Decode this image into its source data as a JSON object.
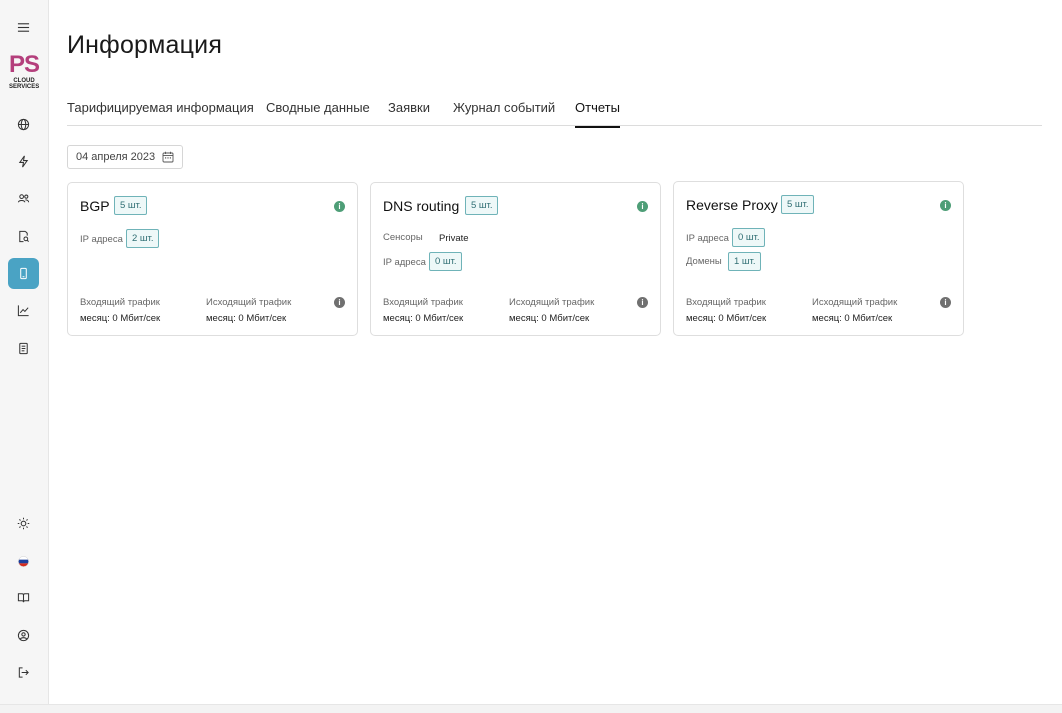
{
  "logo": {
    "ps": "PS",
    "line1": "CLOUD",
    "line2": "SERVICES"
  },
  "page": {
    "title": "Информация"
  },
  "tabs": [
    {
      "label": "Тарифицируемая информация"
    },
    {
      "label": "Сводные данные"
    },
    {
      "label": "Заявки"
    },
    {
      "label": "Журнал событий"
    },
    {
      "label": "Отчеты",
      "active": true
    }
  ],
  "date_picker": {
    "value": "04 апреля 2023"
  },
  "cards": [
    {
      "title": "BGP",
      "count": "5 шт.",
      "rows": [
        {
          "label": "IP адреса",
          "badge": "2 шт."
        }
      ],
      "incoming_label": "Входящий трафик",
      "incoming_value": "месяц: 0 Мбит/сек",
      "outgoing_label": "Исходящий трафик",
      "outgoing_value": "месяц: 0 Мбит/сек"
    },
    {
      "title": "DNS routing",
      "count": "5 шт.",
      "rows": [
        {
          "label": "Сенсоры",
          "value": "Private"
        },
        {
          "label": "IP адреса",
          "badge": "0 шт."
        }
      ],
      "incoming_label": "Входящий трафик",
      "incoming_value": "месяц: 0 Мбит/сек",
      "outgoing_label": "Исходящий трафик",
      "outgoing_value": "месяц: 0 Мбит/сек"
    },
    {
      "title": "Reverse Proxy",
      "count": "5 шт.",
      "rows": [
        {
          "label": "IP адреса",
          "badge": "0 шт."
        },
        {
          "label": "Домены",
          "badge": "1 шт."
        }
      ],
      "incoming_label": "Входящий трафик",
      "incoming_value": "месяц: 0 Мбит/сек",
      "outgoing_label": "Исходящий трафик",
      "outgoing_value": "месяц: 0 Мбит/сек"
    }
  ],
  "colors": {
    "accent": "#4aa3c4",
    "brand": "#b43f7c",
    "badge_border": "#6fb3b8",
    "info_green": "#4e9e77"
  },
  "icons": {
    "sidebar_top": [
      "menu-icon"
    ],
    "sidebar_nav": [
      "globe-icon",
      "lightning-icon",
      "users-icon",
      "document-search-icon",
      "phone-icon",
      "chart-icon",
      "report-icon"
    ],
    "sidebar_bottom": [
      "sun-icon",
      "flag-icon",
      "book-icon",
      "profile-icon",
      "logout-icon"
    ]
  }
}
